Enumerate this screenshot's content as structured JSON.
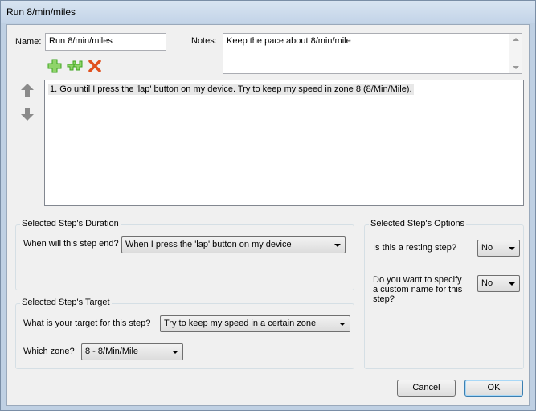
{
  "window": {
    "title": "Run 8/min/miles"
  },
  "form": {
    "name_label": "Name:",
    "name_value": "Run 8/min/miles",
    "notes_label": "Notes:",
    "notes_value": "Keep the pace about 8/min/mile"
  },
  "toolbar": {
    "add_icon": "plus-icon",
    "add_repeat_icon": "add-repeat-icon",
    "delete_icon": "delete-x-icon"
  },
  "steps": [
    "1. Go until I press the 'lap' button on my device. Try to keep my speed in zone 8 (8/Min/Mile)."
  ],
  "duration": {
    "legend": "Selected Step's Duration",
    "question": "When will this step end?",
    "value": "When I press the 'lap' button on my device"
  },
  "target": {
    "legend": "Selected Step's Target",
    "question": "What is your target for this step?",
    "value": "Try to keep my speed in a certain zone",
    "zone_label": "Which zone?",
    "zone_value": "8 - 8/Min/Mile"
  },
  "options": {
    "legend": "Selected Step's Options",
    "resting_question": "Is this a resting step?",
    "resting_value": "No",
    "custom_name_question": "Do you want to specify a custom name for this step?",
    "custom_name_value": "No"
  },
  "buttons": {
    "cancel": "Cancel",
    "ok": "OK"
  },
  "colors": {
    "add_green": "#3ea51f",
    "delete_red": "#e0501e",
    "arrow_gray": "#8a8a8a"
  }
}
